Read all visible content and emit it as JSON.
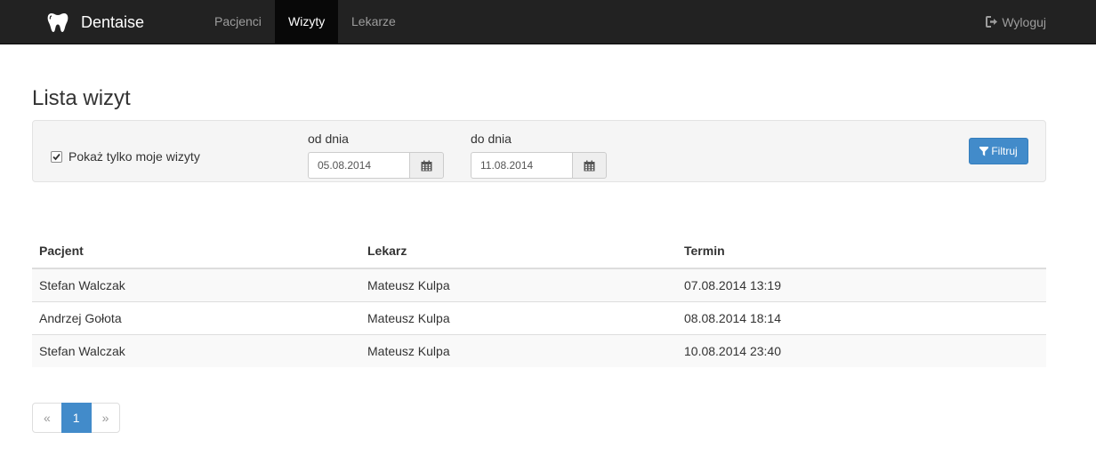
{
  "navbar": {
    "brand": "Dentaise",
    "brand_icon": "tooth-icon",
    "items": [
      {
        "label": "Pacjenci",
        "active": false
      },
      {
        "label": "Wizyty",
        "active": true
      },
      {
        "label": "Lekarze",
        "active": false
      }
    ],
    "logout_label": "Wyloguj",
    "logout_icon": "sign-out-icon"
  },
  "page": {
    "title": "Lista wizyt"
  },
  "filter": {
    "only_mine_label": "Pokaż tylko moje wizyty",
    "only_mine_checked": true,
    "from_label": "od dnia",
    "from_value": "05.08.2014",
    "to_label": "do dnia",
    "to_value": "11.08.2014",
    "button_label": "Filtruj",
    "button_icon": "filter-icon",
    "calendar_icon": "calendar-icon"
  },
  "table": {
    "columns": [
      "Pacjent",
      "Lekarz",
      "Termin"
    ],
    "rows": [
      [
        "Stefan Walczak",
        "Mateusz Kulpa",
        "07.08.2014 13:19"
      ],
      [
        "Andrzej Gołota",
        "Mateusz Kulpa",
        "08.08.2014 18:14"
      ],
      [
        "Stefan Walczak",
        "Mateusz Kulpa",
        "10.08.2014 23:40"
      ]
    ]
  },
  "pagination": {
    "prev": "«",
    "current": "1",
    "next": "»"
  },
  "colors": {
    "navbar_bg": "#222222",
    "active_nav_bg": "#080808",
    "primary": "#428bca"
  }
}
